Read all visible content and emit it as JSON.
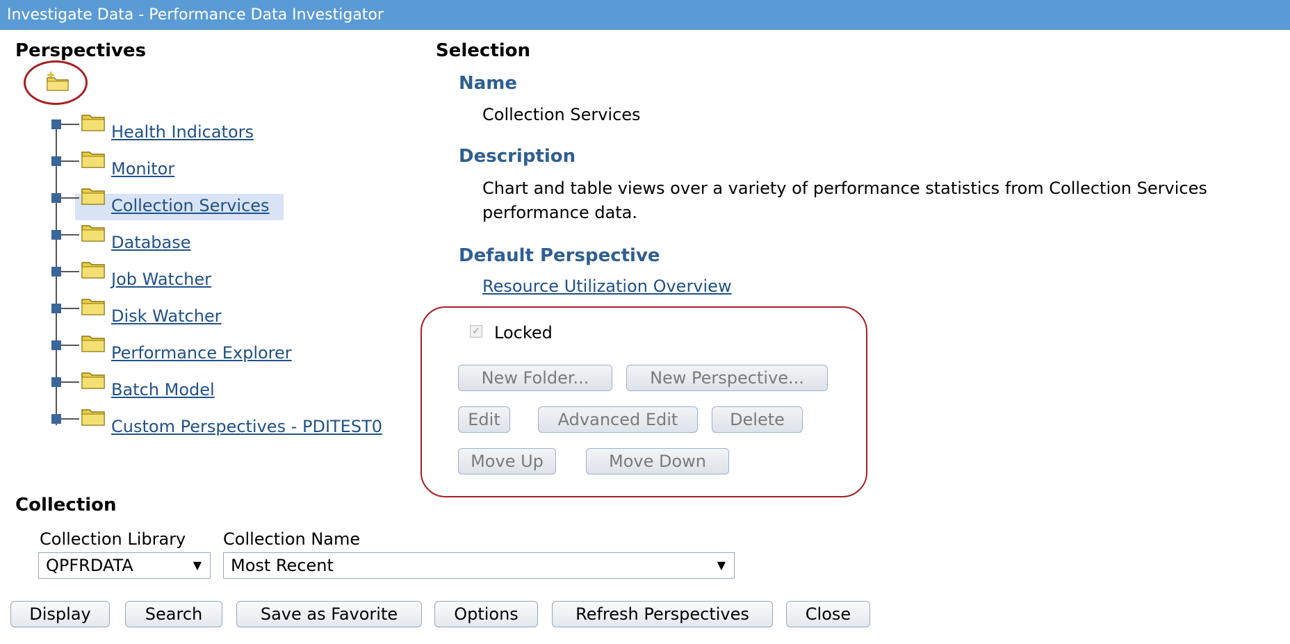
{
  "window": {
    "title": "Investigate Data - Performance Data Investigator"
  },
  "perspectives": {
    "heading": "Perspectives",
    "tree": [
      {
        "label": "Health Indicators"
      },
      {
        "label": "Monitor"
      },
      {
        "label": "Collection Services",
        "selected": true
      },
      {
        "label": "Database"
      },
      {
        "label": "Job Watcher"
      },
      {
        "label": "Disk Watcher"
      },
      {
        "label": "Performance Explorer"
      },
      {
        "label": "Batch Model"
      },
      {
        "label": "Custom Perspectives - PDITEST0"
      }
    ]
  },
  "selection": {
    "heading": "Selection",
    "name_label": "Name",
    "name_value": "Collection Services",
    "description_label": "Description",
    "description_line1": "Chart and table views over a variety of performance statistics from Collection Services",
    "description_line2": "performance data.",
    "default_perspective_label": "Default Perspective",
    "default_perspective_link": "Resource Utilization Overview",
    "locked_label": "Locked",
    "locked_checked": true,
    "buttons": {
      "new_folder": "New Folder...",
      "new_perspective": "New Perspective...",
      "edit": "Edit",
      "advanced_edit": "Advanced Edit",
      "delete": "Delete",
      "move_up": "Move Up",
      "move_down": "Move Down"
    }
  },
  "collection": {
    "heading": "Collection",
    "library_label": "Collection Library",
    "library_value": "QPFRDATA",
    "name_label": "Collection Name",
    "name_value": "Most Recent"
  },
  "actions": {
    "display": "Display",
    "search": "Search",
    "save_favorite": "Save as Favorite",
    "options": "Options",
    "refresh": "Refresh Perspectives",
    "close": "Close"
  },
  "colors": {
    "titlebar": "#5b9bd5",
    "subheading": "#2e5f92",
    "link": "#1f5188",
    "annotation": "#a81e22",
    "selected_row": "#d9e3f6"
  }
}
